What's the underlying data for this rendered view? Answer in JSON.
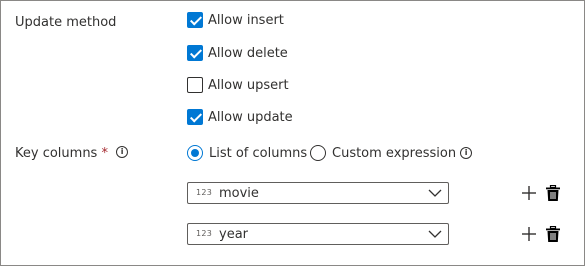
{
  "update_method": {
    "label": "Update method",
    "options": [
      {
        "label": "Allow insert",
        "checked": true
      },
      {
        "label": "Allow delete",
        "checked": true
      },
      {
        "label": "Allow upsert",
        "checked": false
      },
      {
        "label": "Allow update",
        "checked": true
      }
    ]
  },
  "key_columns": {
    "label": "Key columns",
    "required_mark": "*",
    "info_icon": "i",
    "radio_options": [
      {
        "label": "List of columns",
        "selected": true
      },
      {
        "label": "Custom expression",
        "selected": false
      }
    ],
    "custom_expression_info_icon": "i",
    "columns": [
      {
        "type_badge": "123",
        "value": "movie"
      },
      {
        "type_badge": "123",
        "value": "year"
      }
    ]
  },
  "colors": {
    "accent": "#0078d4",
    "required": "#a4262c",
    "text": "#323130",
    "border": "#605e5c"
  },
  "icons": [
    "checkbox-checked",
    "checkbox-unchecked",
    "radio-selected",
    "radio-unselected",
    "info-icon",
    "chevron-down-icon",
    "plus-icon",
    "trash-icon"
  ]
}
